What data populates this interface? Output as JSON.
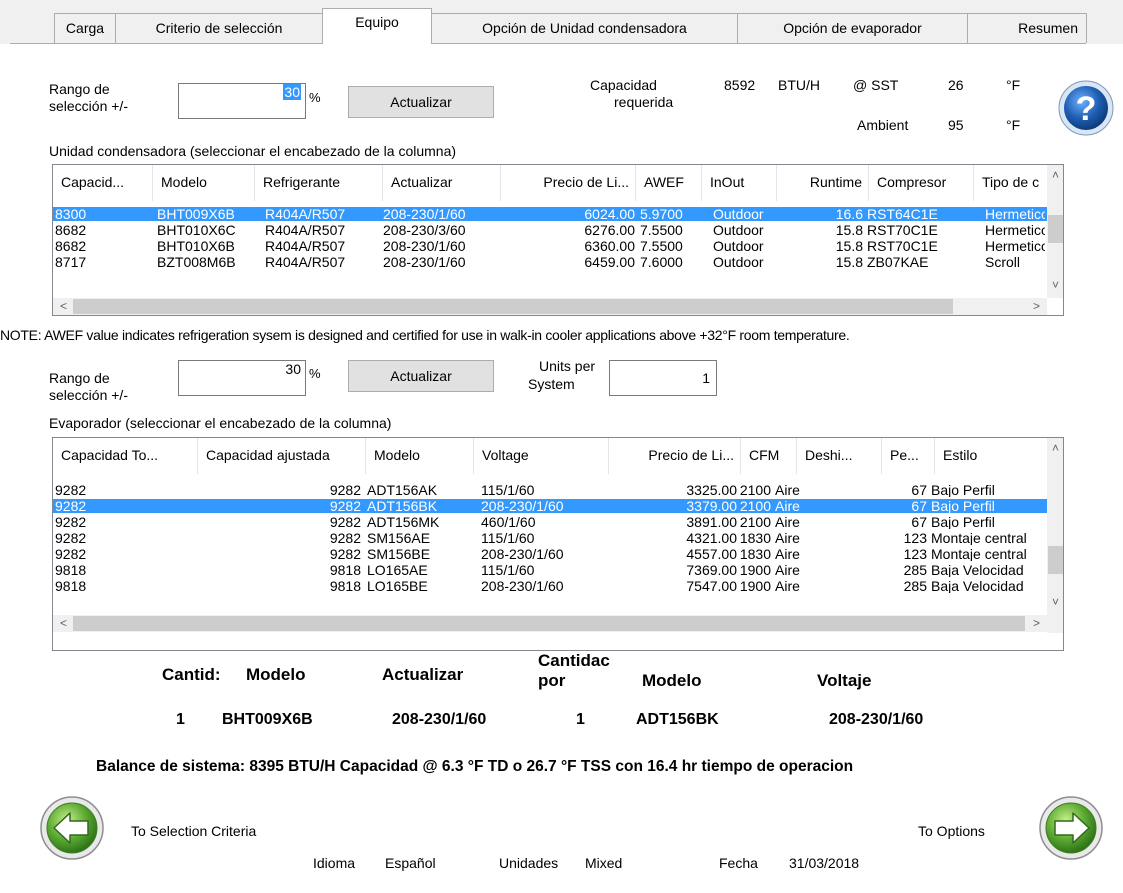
{
  "tabs": [
    "Carga",
    "Criterio de selección",
    "Equipo",
    "Opción de Unidad condensadora",
    "Opción de evaporador",
    "Resumen"
  ],
  "condenser": {
    "range_label_1": "Rango de",
    "range_label_2": "selección +/-",
    "range_value": "30",
    "percent": "%",
    "update_button": "Actualizar",
    "capacity_label_1": "Capacidad",
    "capacity_label_2": "requerida",
    "capacity_value": "8592",
    "capacity_unit": "BTU/H",
    "sst_label": "@ SST",
    "sst_value": "26",
    "sst_unit": "°F",
    "ambient_label": "Ambient",
    "ambient_value": "95",
    "ambient_unit": "°F",
    "table_title": "Unidad condensadora (seleccionar el encabezado de la columna)",
    "columns": [
      "Capacid...",
      "Modelo",
      "Refrigerante",
      "Actualizar",
      "Precio de Li...",
      "AWEF",
      "InOut",
      "Runtime",
      "Compresor",
      "Tipo de c"
    ],
    "rows": [
      [
        "8300",
        "BHT009X6B",
        "R404A/R507",
        "208-230/1/60",
        "6024.00",
        "5.9700",
        "Outdoor",
        "16.6",
        "RST64C1E",
        "Hermetico"
      ],
      [
        "8682",
        "BHT010X6C",
        "R404A/R507",
        "208-230/3/60",
        "6276.00",
        "7.5500",
        "Outdoor",
        "15.8",
        "RST70C1E",
        "Hermetico"
      ],
      [
        "8682",
        "BHT010X6B",
        "R404A/R507",
        "208-230/1/60",
        "6360.00",
        "7.5500",
        "Outdoor",
        "15.8",
        "RST70C1E",
        "Hermetico"
      ],
      [
        "8717",
        "BZT008M6B",
        "R404A/R507",
        "208-230/1/60",
        "6459.00",
        "7.6000",
        "Outdoor",
        "15.8",
        "ZB07KAE",
        "Scroll"
      ]
    ],
    "selected_row": 0
  },
  "note": "NOTE: AWEF value indicates refrigeration sysem is designed and certified for use in walk-in cooler applications above +32°F room temperature.",
  "evaporator": {
    "range_label_1": "Rango de",
    "range_label_2": "selección +/-",
    "range_value": "30",
    "percent": "%",
    "update_button": "Actualizar",
    "units_label_1": "Units per",
    "units_label_2": "System",
    "units_value": "1",
    "table_title": "Evaporador (seleccionar el encabezado de la columna)",
    "columns": [
      "Capacidad To...",
      "Capacidad ajustada",
      "Modelo",
      "Voltage",
      "Precio de Li...",
      "CFM",
      "Deshi...",
      "Pe...",
      "Estilo"
    ],
    "rows": [
      [
        "9282",
        "9282",
        "ADT156AK",
        "115/1/60",
        "3325.00",
        "2100",
        "Aire",
        "67",
        "Bajo Perfil"
      ],
      [
        "9282",
        "9282",
        "ADT156BK",
        "208-230/1/60",
        "3379.00",
        "2100",
        "Aire",
        "67",
        "Bajo Perfil"
      ],
      [
        "9282",
        "9282",
        "ADT156MK",
        "460/1/60",
        "3891.00",
        "2100",
        "Aire",
        "67",
        "Bajo Perfil"
      ],
      [
        "9282",
        "9282",
        "SM156AE",
        "115/1/60",
        "4321.00",
        "1830",
        "Aire",
        "123",
        "Montaje central"
      ],
      [
        "9282",
        "9282",
        "SM156BE",
        "208-230/1/60",
        "4557.00",
        "1830",
        "Aire",
        "123",
        "Montaje central"
      ],
      [
        "9818",
        "9818",
        "LO165AE",
        "115/1/60",
        "7369.00",
        "1900",
        "Aire",
        "285",
        "Baja Velocidad"
      ],
      [
        "9818",
        "9818",
        "LO165BE",
        "208-230/1/60",
        "7547.00",
        "1900",
        "Aire",
        "285",
        "Baja Velocidad"
      ]
    ],
    "selected_row": 1
  },
  "summary": {
    "h_cantidad": "Cantid:",
    "h_modelo": "Modelo",
    "h_actualizar": "Actualizar",
    "h_cantidad_por_1": "Cantidac",
    "h_cantidad_por_2": "por",
    "h_modelo2": "Modelo",
    "h_voltaje": "Voltaje",
    "v_cantidad": "1",
    "v_modelo": "BHT009X6B",
    "v_actualizar": "208-230/1/60",
    "v_cantidad_por": "1",
    "v_modelo2": "ADT156BK",
    "v_voltaje": "208-230/1/60",
    "balance": "Balance de sistema: 8395 BTU/H Capacidad @ 6.3 °F TD o 26.7 °F TSS con 16.4 hr tiempo de operacion"
  },
  "footer": {
    "back_label": "To Selection Criteria",
    "next_label": "To Options",
    "idioma_label": "Idioma",
    "idioma_value": "Español",
    "unidades_label": "Unidades",
    "unidades_value": "Mixed",
    "fecha_label": "Fecha",
    "fecha_value": "31/03/2018"
  },
  "colors": {
    "selection": "#3399ff",
    "help_blue": "#1e5fb4",
    "arrow_green": "#5aa832"
  },
  "icons": {
    "help": "help-icon",
    "back": "arrow-left-icon",
    "next": "arrow-right-icon"
  }
}
